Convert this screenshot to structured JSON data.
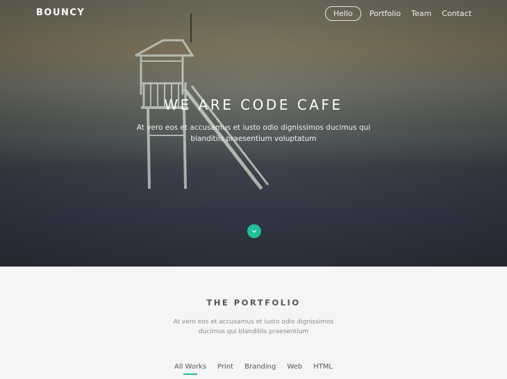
{
  "brand": {
    "logo": "BOUNCY"
  },
  "nav": {
    "items": [
      {
        "label": "Hello",
        "active": true
      },
      {
        "label": "Portfolio",
        "active": false
      },
      {
        "label": "Team",
        "active": false
      },
      {
        "label": "Contact",
        "active": false
      }
    ]
  },
  "hero": {
    "title": "WE ARE CODE CAFE",
    "subtitle": "At vero eos et accusamus et iusto odio dignissimos ducimus qui blanditiis praesentium voluptatum",
    "scroll_icon": "chevron-down-icon"
  },
  "portfolio": {
    "title": "THE PORTFOLIO",
    "subtitle": "At vero eos et accusamus et iusto odio dignissimos ducimus qui blanditiis praesentium",
    "filters": [
      {
        "label": "All Works",
        "active": true
      },
      {
        "label": "Print",
        "active": false
      },
      {
        "label": "Branding",
        "active": false
      },
      {
        "label": "Web",
        "active": false
      },
      {
        "label": "HTML",
        "active": false
      }
    ]
  },
  "colors": {
    "accent": "#1fbf99",
    "hero_text": "#ffffff",
    "section_bg": "#f5f5f5"
  }
}
